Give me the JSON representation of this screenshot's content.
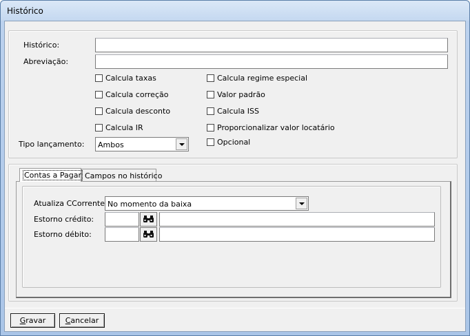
{
  "window": {
    "title": "Histórico"
  },
  "form": {
    "historico_label": "Histórico:",
    "historico_value": "",
    "abreviacao_label": "Abreviação:",
    "abreviacao_value": "",
    "checkboxes_left": [
      {
        "label": "Calcula taxas",
        "checked": false
      },
      {
        "label": "Calcula correção",
        "checked": false
      },
      {
        "label": "Calcula desconto",
        "checked": false
      },
      {
        "label": "Calcula IR",
        "checked": false
      }
    ],
    "checkboxes_right": [
      {
        "label": "Calcula regime especial",
        "checked": false
      },
      {
        "label": "Valor padrão",
        "checked": false
      },
      {
        "label": "Calcula ISS",
        "checked": false
      },
      {
        "label": "Proporcionalizar valor locatário",
        "checked": false
      },
      {
        "label": "Opcional",
        "checked": false
      }
    ],
    "tipo_label": "Tipo lançamento:",
    "tipo_value": "Ambos"
  },
  "tabs": [
    {
      "label": "Contas a Pagar",
      "active": true
    },
    {
      "label": "Campos no histórico",
      "active": false
    }
  ],
  "contas": {
    "atualiza_label": "Atualiza CCorrente:",
    "atualiza_value": "No momento da baixa",
    "estorno_credito_label": "Estorno crédito:",
    "estorno_credito_code": "",
    "estorno_credito_desc": "",
    "estorno_debito_label": "Estorno débito:",
    "estorno_debito_code": "",
    "estorno_debito_desc": ""
  },
  "buttons": {
    "gravar_first": "G",
    "gravar_rest": "ravar",
    "cancelar_first": "C",
    "cancelar_rest": "ancelar"
  }
}
